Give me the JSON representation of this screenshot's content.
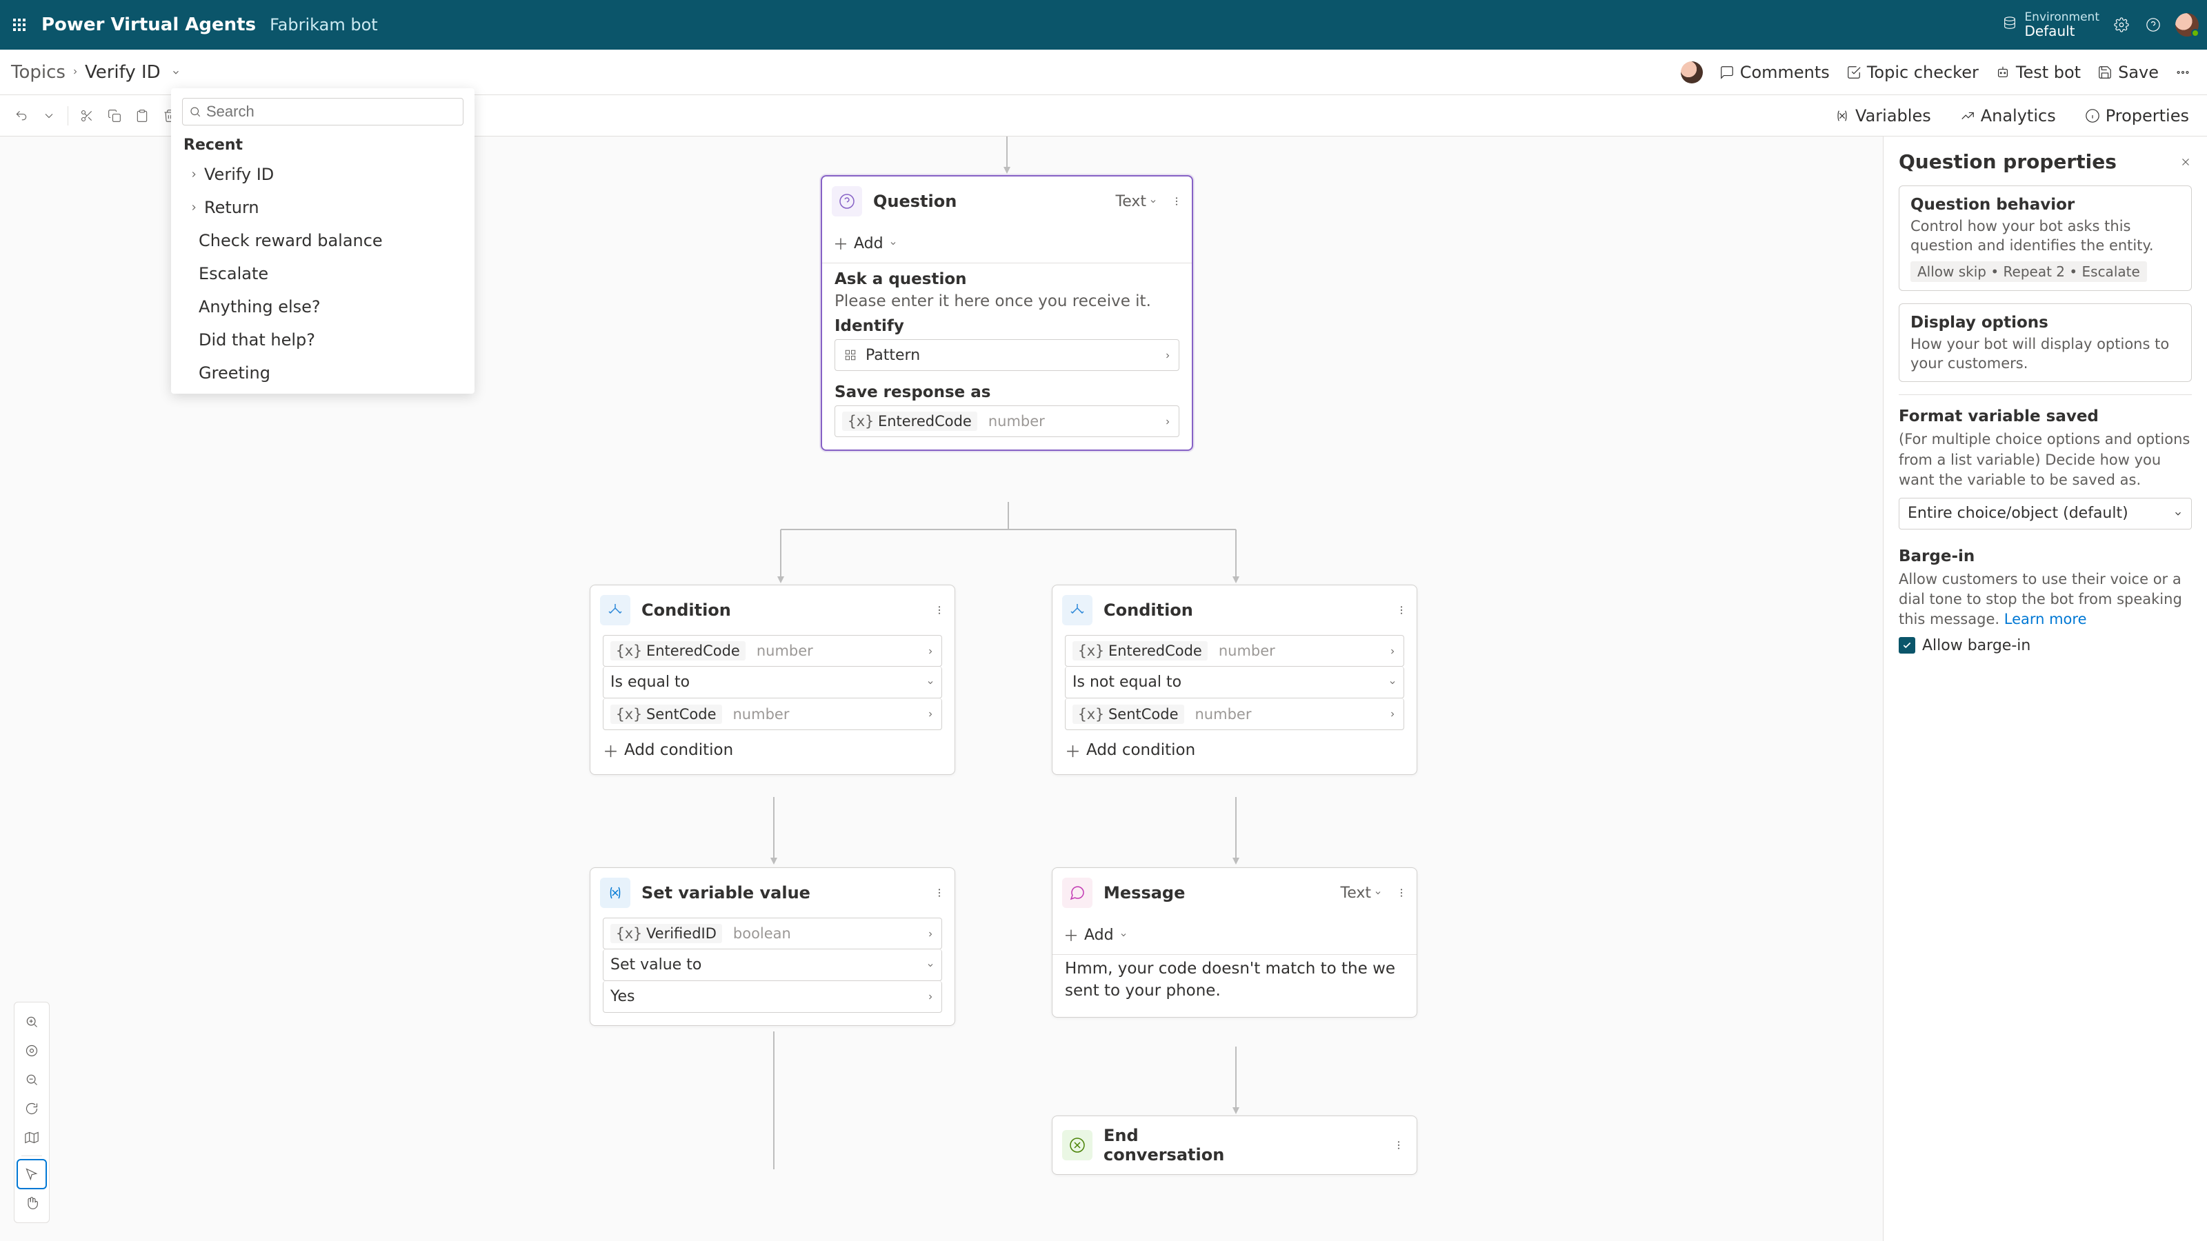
{
  "app": {
    "title": "Power Virtual Agents",
    "bot": "Fabrikam bot"
  },
  "environment": {
    "label": "Environment",
    "value": "Default"
  },
  "breadcrumb": {
    "root": "Topics",
    "current": "Verify ID"
  },
  "commands": {
    "comments": "Comments",
    "topic_checker": "Topic checker",
    "test_bot": "Test bot",
    "save": "Save",
    "variables": "Variables",
    "analytics": "Analytics",
    "properties": "Properties"
  },
  "recent": {
    "search_placeholder": "Search",
    "heading": "Recent",
    "items": [
      "Verify ID",
      "Return",
      "Check reward balance",
      "Escalate",
      "Anything else?",
      "Did that help?",
      "Greeting"
    ]
  },
  "nodes": {
    "question": {
      "title": "Question",
      "type_label": "Text",
      "add": "Add",
      "ask_label": "Ask a question",
      "ask_text": "Please enter it here once you receive it.",
      "identify_label": "Identify",
      "identify_value": "Pattern",
      "save_label": "Save response as",
      "save_var": "EnteredCode",
      "save_type": "number"
    },
    "cond_left": {
      "title": "Condition",
      "var1": "EnteredCode",
      "type1": "number",
      "op": "Is equal to",
      "var2": "SentCode",
      "type2": "number",
      "add": "Add condition"
    },
    "cond_right": {
      "title": "Condition",
      "var1": "EnteredCode",
      "type1": "number",
      "op": "Is not equal to",
      "var2": "SentCode",
      "type2": "number",
      "add": "Add condition"
    },
    "setvar": {
      "title": "Set variable value",
      "var": "VerifiedID",
      "type": "boolean",
      "op": "Set value to",
      "val": "Yes"
    },
    "message": {
      "title": "Message",
      "type_label": "Text",
      "add": "Add",
      "body": "Hmm, your code doesn't match to the we sent to your phone."
    },
    "end": {
      "title": "End conversation"
    }
  },
  "props": {
    "heading": "Question properties",
    "behavior": {
      "title": "Question behavior",
      "desc": "Control how your bot asks this question and identifies the entity.",
      "badge": "Allow skip • Repeat 2 • Escalate"
    },
    "display": {
      "title": "Display options",
      "desc": "How your bot will display options to your customers."
    },
    "format": {
      "title": "Format variable saved",
      "desc": "(For multiple choice options and options from a list variable) Decide how you want the variable to be saved as.",
      "value": "Entire choice/object (default)"
    },
    "barge": {
      "title": "Barge-in",
      "desc_a": "Allow customers to use their voice or a dial tone to stop the bot from speaking this message. ",
      "learn": "Learn more",
      "checkbox": "Allow barge-in"
    }
  }
}
